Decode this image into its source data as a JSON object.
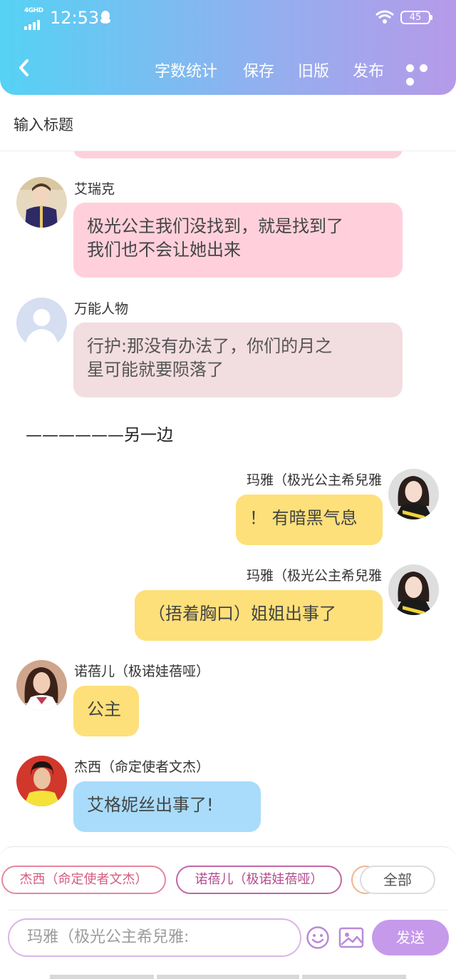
{
  "status_bar": {
    "network": "4GHD",
    "time": "12:53",
    "battery": "45"
  },
  "toolbar": {
    "word_count": "字数统计",
    "save": "保存",
    "old_version": "旧版",
    "publish": "发布"
  },
  "title_placeholder": "输入标题",
  "messages": [
    {
      "name": "艾瑞克",
      "line1": "极光公主我们没找到，就是找到了",
      "line2": "我们也不会让她出来"
    },
    {
      "name": "万能人物",
      "line1": "行护:那没有办法了，你们的月之",
      "line2": "星可能就要陨落了"
    },
    {
      "divider": "——————另一边"
    },
    {
      "name": "玛雅（极光公主希兒雅",
      "text": "！ 有暗黑气息"
    },
    {
      "name": "玛雅（极光公主希兒雅",
      "text": "（捂着胸口）姐姐出事了"
    },
    {
      "name": "诺蓓儿（极诺娃蓓哑）",
      "text": "公主"
    },
    {
      "name": "杰西（命定使者文杰）",
      "text": "艾格妮丝出事了!"
    }
  ],
  "bottom": {
    "role_chips": [
      "杰西（命定使者文杰）",
      "诺蓓儿（极诺娃蓓哑）"
    ],
    "all_label": "全部",
    "input_placeholder": "玛雅（极光公主希兒雅:",
    "send_label": "发送"
  }
}
